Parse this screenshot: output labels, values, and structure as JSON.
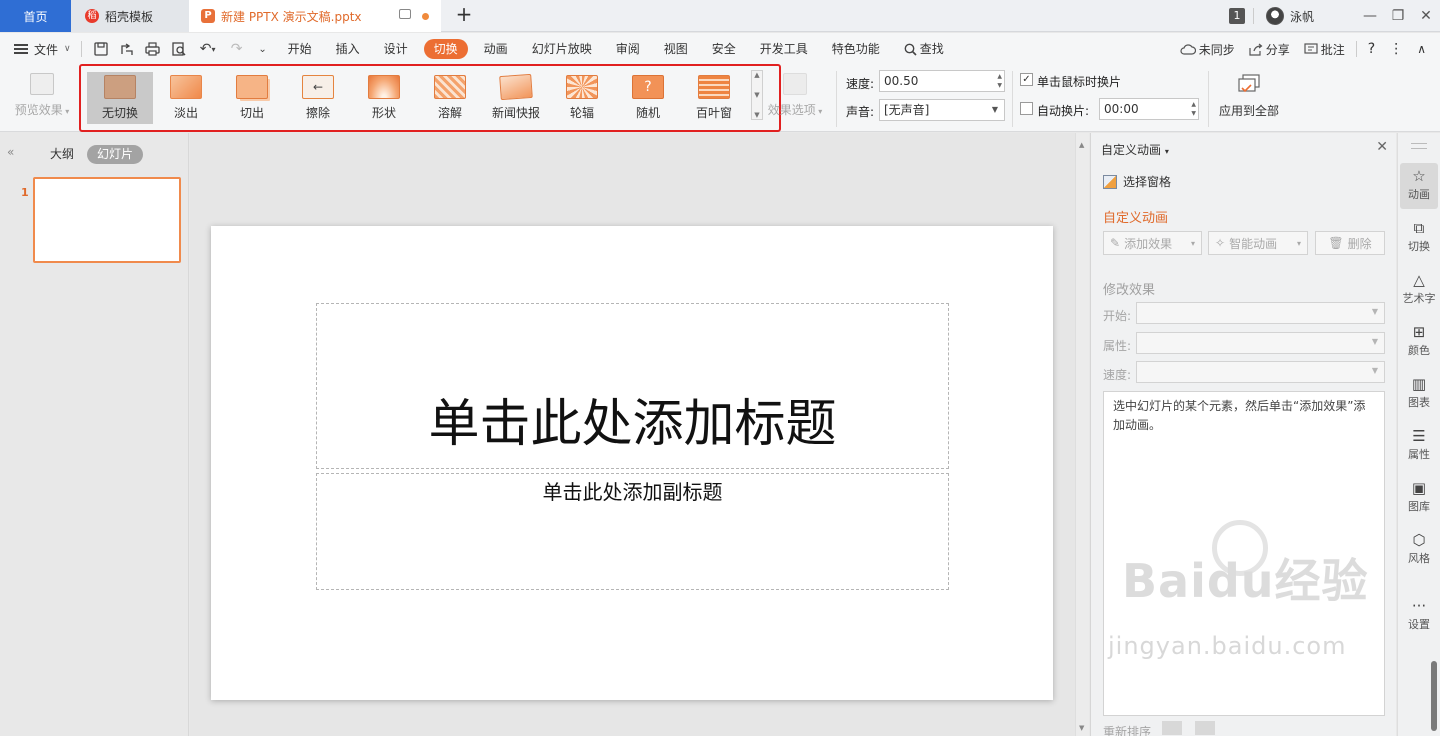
{
  "titlebar": {
    "home_tab": "首页",
    "template_tab": "稻壳模板",
    "doc_tab": "新建 PPTX 演示文稿.pptx",
    "badge": "1",
    "user": "泳帆",
    "minimize": "—",
    "restore": "❐",
    "close": "✕"
  },
  "menubar": {
    "file": "文件",
    "tabs": [
      "开始",
      "插入",
      "设计",
      "切换",
      "动画",
      "幻灯片放映",
      "审阅",
      "视图",
      "安全",
      "开发工具",
      "特色功能"
    ],
    "active_tab": "切换",
    "search": "查找",
    "sync": "未同步",
    "share": "分享",
    "comment": "批注",
    "help": "?"
  },
  "ribbon": {
    "preview": "预览效果",
    "transitions": [
      "无切换",
      "淡出",
      "切出",
      "擦除",
      "形状",
      "溶解",
      "新闻快报",
      "轮辐",
      "随机",
      "百叶窗"
    ],
    "selected_transition": "无切换",
    "random_glyph": "?",
    "wipe_glyph": "←",
    "effect_options": "效果选项",
    "speed_label": "速度:",
    "speed_value": "00.50",
    "sound_label": "声音:",
    "sound_value": "[无声音]",
    "click_advance_label": "单击鼠标时换片",
    "click_advance_checked": true,
    "auto_advance_label": "自动换片:",
    "auto_advance_checked": false,
    "auto_advance_value": "00:00",
    "apply_all": "应用到全部"
  },
  "leftpanel": {
    "outline_tab": "大纲",
    "slides_tab": "幻灯片",
    "slide_number": "1"
  },
  "slide": {
    "title_placeholder": "单击此处添加标题",
    "subtitle_placeholder": "单击此处添加副标题"
  },
  "taskpane": {
    "header": "自定义动画",
    "select_pane": "选择窗格",
    "section_title": "自定义动画",
    "add_effect": "添加效果",
    "smart_animation": "智能动画",
    "delete": "删除",
    "modify_effect": "修改效果",
    "start_label": "开始:",
    "property_label": "属性:",
    "speed_label": "速度:",
    "hint": "选中幻灯片的某个元素，然后单击“添加效果”添加动画。",
    "reorder": "重新排序",
    "watermark_main": "Baidu经验",
    "watermark_sub": "jingyan.baidu.com"
  },
  "sidebar": {
    "items": [
      "动画",
      "切换",
      "艺术字",
      "颜色",
      "图表",
      "属性",
      "图库",
      "风格",
      "设置"
    ],
    "active": "动画"
  },
  "colors": {
    "accent": "#ec6e33",
    "highlight_box": "#e12020",
    "home_tab": "#2f6ed4"
  }
}
